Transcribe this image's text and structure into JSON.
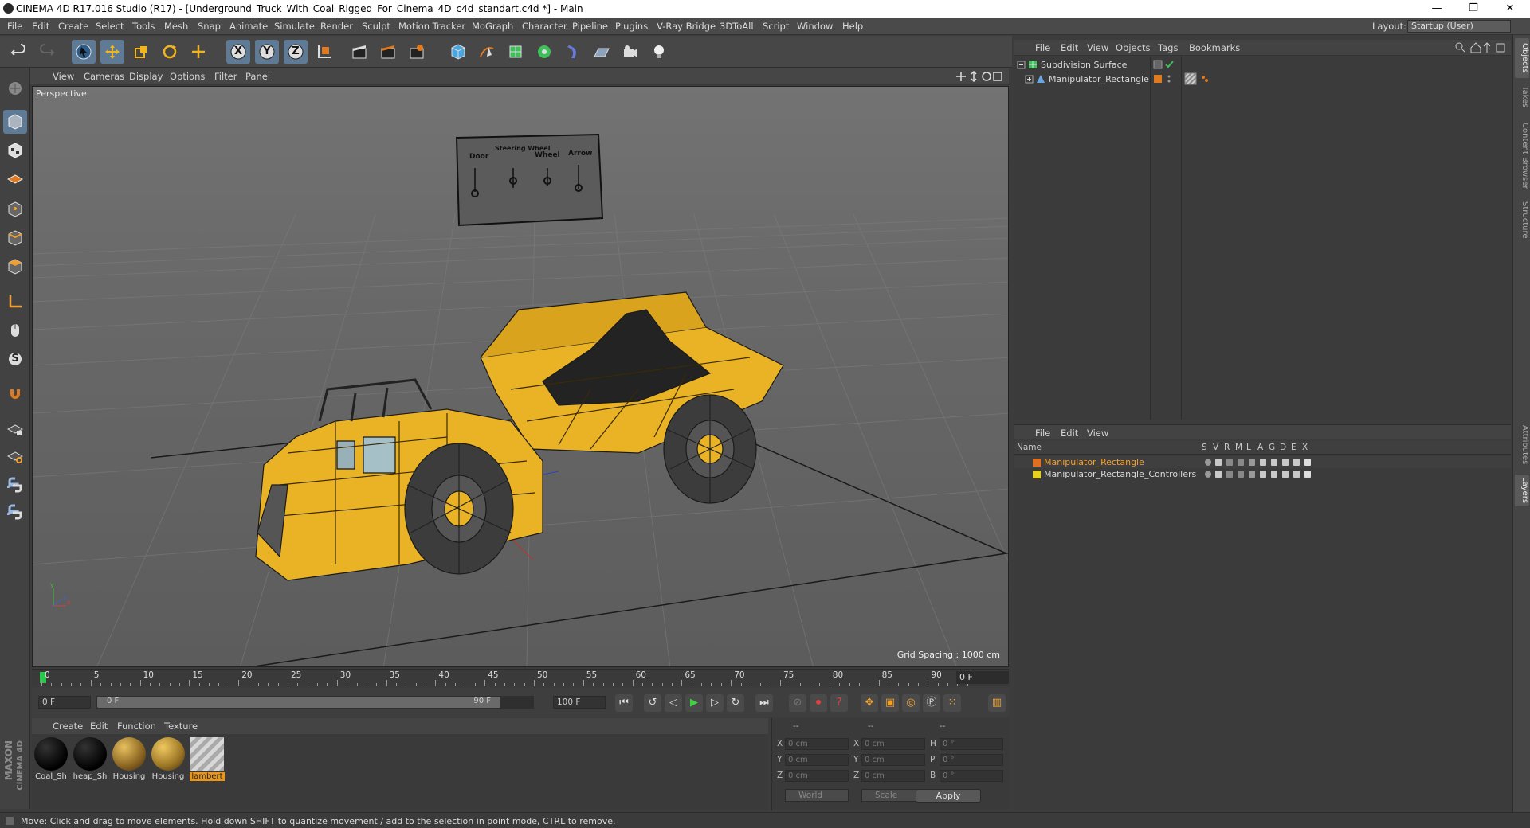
{
  "window": {
    "title": "CINEMA 4D R17.016 Studio (R17) - [Underground_Truck_With_Coal_Rigged_For_Cinema_4D_c4d_standart.c4d *] - Main",
    "minimize": "—",
    "restore": "❐",
    "close": "✕"
  },
  "menubar": {
    "items": [
      "File",
      "Edit",
      "Create",
      "Select",
      "Tools",
      "Mesh",
      "Snap",
      "Animate",
      "Simulate",
      "Render",
      "Sculpt",
      "Motion Tracker",
      "MoGraph",
      "Character",
      "Pipeline",
      "Plugins",
      "V-Ray Bridge",
      "3DToAll",
      "Script",
      "Window",
      "Help"
    ],
    "layout_label": "Layout:",
    "layout_value": "Startup (User)"
  },
  "toolbar": {
    "axis_x": "X",
    "axis_y": "Y",
    "axis_z": "Z"
  },
  "viewport": {
    "menu": [
      "View",
      "Cameras",
      "Display",
      "Options",
      "Filter",
      "Panel"
    ],
    "camera_label": "Perspective",
    "grid_spacing": "Grid Spacing : 1000 cm",
    "controller_labels": [
      "Door",
      "Steering Wheel",
      "Wheel",
      "Arrow"
    ]
  },
  "timeline": {
    "ticks": [
      "0",
      "5",
      "10",
      "15",
      "20",
      "25",
      "30",
      "35",
      "40",
      "45",
      "50",
      "55",
      "60",
      "65",
      "70",
      "75",
      "80",
      "85",
      "90"
    ],
    "current_frame": "0 F",
    "start_field": "0 F",
    "range_start": "0 F",
    "range_end": "90 F",
    "end_field": "100 F"
  },
  "materials": {
    "menu": [
      "Create",
      "Edit",
      "Function",
      "Texture"
    ],
    "items": [
      {
        "label": "Coal_Sh",
        "kind": "black"
      },
      {
        "label": "heap_Sh",
        "kind": "black"
      },
      {
        "label": "Housing",
        "kind": "yellow"
      },
      {
        "label": "Housing",
        "kind": "yellow"
      },
      {
        "label": "lambert",
        "kind": "stripe",
        "selected": true
      }
    ]
  },
  "coordinates": {
    "header": [
      "--",
      "--",
      "--"
    ],
    "rows": [
      {
        "a": "X",
        "av": "0 cm",
        "b": "X",
        "bv": "0 cm",
        "c": "H",
        "cv": "0 °"
      },
      {
        "a": "Y",
        "av": "0 cm",
        "b": "Y",
        "bv": "0 cm",
        "c": "P",
        "cv": "0 °"
      },
      {
        "a": "Z",
        "av": "0 cm",
        "b": "Z",
        "bv": "0 cm",
        "c": "B",
        "cv": "0 °"
      }
    ],
    "world": "World",
    "scale": "Scale",
    "apply": "Apply"
  },
  "objects": {
    "menu": [
      "File",
      "Edit",
      "View",
      "Objects",
      "Tags",
      "Bookmarks"
    ],
    "items": [
      {
        "name": "Subdivision Surface"
      },
      {
        "name": "Manipulator_Rectangle"
      }
    ]
  },
  "layers": {
    "menu": [
      "File",
      "Edit",
      "View"
    ],
    "columns": [
      "Name",
      "S",
      "V",
      "R",
      "M",
      "L",
      "A",
      "G",
      "D",
      "E",
      "X"
    ],
    "items": [
      {
        "name": "Manipulator_Rectangle",
        "color": "#e07020",
        "text_color": "#f0a030"
      },
      {
        "name": "Manipulator_Rectangle_Controllers",
        "color": "#e8d020",
        "text_color": "#d8d8d8"
      }
    ]
  },
  "side_tabs": [
    "Objects",
    "Takes",
    "Content Browser",
    "Structure",
    "Attributes",
    "Layers"
  ],
  "status": "Move: Click and drag to move elements. Hold down SHIFT to quantize movement / add to the selection in point mode, CTRL to remove.",
  "logo": {
    "line1": "MAXON",
    "line2": "CINEMA 4D"
  },
  "colors": {
    "accent": "#f0a030",
    "truck_yellow": "#e8b020",
    "selection_blue": "#5f7a94"
  }
}
